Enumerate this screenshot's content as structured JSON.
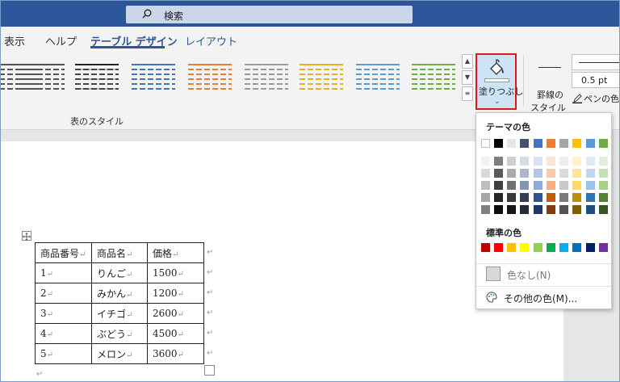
{
  "search": {
    "label": "検索"
  },
  "tabs": [
    {
      "label": "表示"
    },
    {
      "label": "ヘルプ"
    },
    {
      "label": "テーブル デザイン"
    },
    {
      "label": "レイアウト"
    }
  ],
  "ribbon": {
    "group_label": "表のスタイル",
    "fill_label": "塗りつぶし",
    "border_style_label_1": "罫線の",
    "border_style_label_2": "スタイル",
    "pen_weight": "0.5 pt",
    "pen_color_label": "ペンの色"
  },
  "table": {
    "header": [
      "商品番号",
      "商品名",
      "価格"
    ],
    "rows": [
      [
        "1",
        "りんご",
        "1500"
      ],
      [
        "2",
        "みかん",
        "1200"
      ],
      [
        "3",
        "イチゴ",
        "2600"
      ],
      [
        "4",
        "ぶどう",
        "4500"
      ],
      [
        "5",
        "メロン",
        "3600"
      ]
    ]
  },
  "dropdown": {
    "theme_colors_label": "テーマの色",
    "standard_colors_label": "標準の色",
    "no_color_label": "色なし(N)",
    "more_colors_label": "その他の色(M)...",
    "theme_top_row": [
      "#ffffff",
      "#000000",
      "#e7e6e6",
      "#44546a",
      "#4472c4",
      "#ed7d31",
      "#a5a5a5",
      "#ffc000",
      "#5b9bd5",
      "#70ad47"
    ],
    "theme_shades": [
      [
        "#f2f2f2",
        "#d9d9d9",
        "#bfbfbf",
        "#a6a6a6",
        "#808080"
      ],
      [
        "#7f7f7f",
        "#595959",
        "#404040",
        "#262626",
        "#0d0d0d"
      ],
      [
        "#d0cece",
        "#aeaaaa",
        "#757171",
        "#3a3838",
        "#171616"
      ],
      [
        "#d6dce4",
        "#adb9ca",
        "#8496b0",
        "#333f4f",
        "#222a35"
      ],
      [
        "#d9e2f3",
        "#b4c6e7",
        "#8eaadb",
        "#2f5496",
        "#1f3864"
      ],
      [
        "#fbe5d5",
        "#f7cbac",
        "#f4b083",
        "#c55a11",
        "#833c0b"
      ],
      [
        "#ededed",
        "#dbdbdb",
        "#c9c9c9",
        "#7b7b7b",
        "#525252"
      ],
      [
        "#fff2cc",
        "#fee599",
        "#ffd965",
        "#bf8f00",
        "#7f6000"
      ],
      [
        "#deebf6",
        "#bdd7ee",
        "#9cc3e5",
        "#2e75b5",
        "#1e4e79"
      ],
      [
        "#e2efd9",
        "#c5e0b3",
        "#a8d08d",
        "#538135",
        "#375623"
      ]
    ],
    "standard": [
      "#c00000",
      "#ff0000",
      "#ffc000",
      "#ffff00",
      "#92d050",
      "#00b050",
      "#00b0f0",
      "#0070c0",
      "#002060",
      "#7030a0"
    ]
  }
}
